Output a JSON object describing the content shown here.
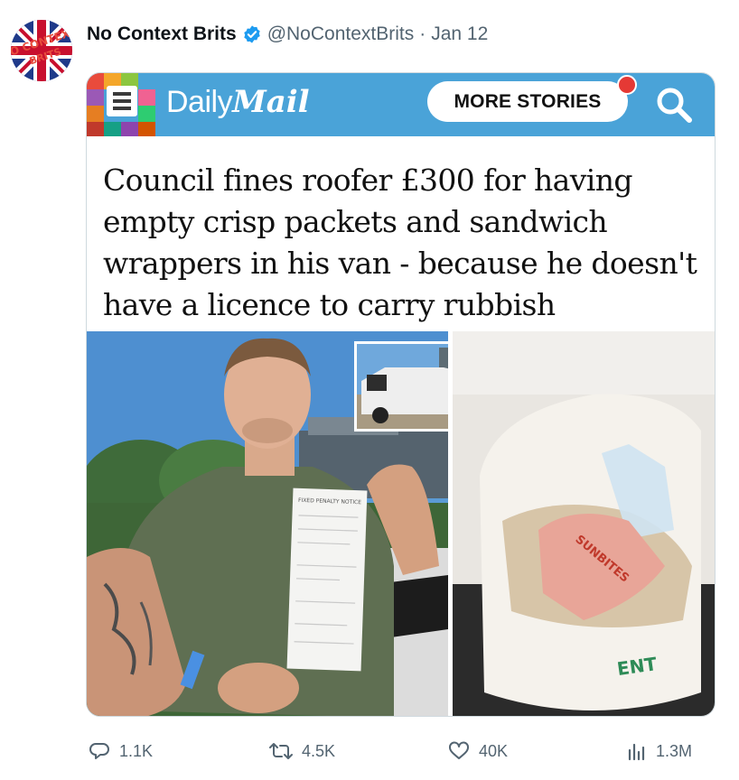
{
  "tweet": {
    "display_name": "No Context Brits",
    "handle": "@NoContextBrits",
    "separator": "·",
    "date": "Jan 12",
    "avatar_text": "NO CONTEXT BRITS"
  },
  "article": {
    "brand_daily": "Daily",
    "brand_mail": "Mail",
    "more_stories_label": "MORE STORIES",
    "headline": "Council fines roofer £300 for having empty crisp packets and sandwich wrappers in his van - because he doesn't have a licence to carry rubbish",
    "notice_title": "FIXED PENALTY NOTICE",
    "packet_brand": "SUNBITES",
    "bag_text": "ENT"
  },
  "actions": {
    "replies": "1.1K",
    "retweets": "4.5K",
    "likes": "40K",
    "views": "1.3M"
  },
  "colors": {
    "dm_blue": "#4aa3d8",
    "verified_blue": "#1d9bf0",
    "muted_text": "#536471"
  }
}
